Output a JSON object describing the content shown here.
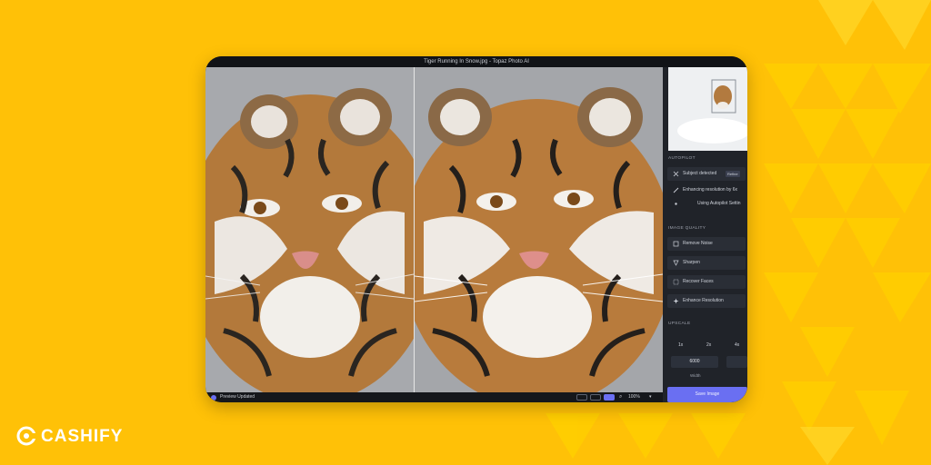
{
  "brand": {
    "name": "CASHIFY"
  },
  "window": {
    "title": "Tiger Running In Snow.jpg - Topaz Photo AI"
  },
  "status": {
    "text": "Preview Updated",
    "zoom": "100%"
  },
  "panel": {
    "autopilot_label": "AUTOPILOT",
    "autopilot_items": [
      {
        "label": "Subject detected",
        "badge": "Refine"
      },
      {
        "label": "Enhancing resolution by 6x"
      },
      {
        "label": "Using Autopilot Settin"
      }
    ],
    "quality_label": "IMAGE QUALITY",
    "quality_items": [
      {
        "label": "Remove Noise"
      },
      {
        "label": "Sharpen"
      },
      {
        "label": "Recover Faces"
      },
      {
        "label": "Enhance Resolution"
      }
    ],
    "upscale_label": "UPSCALE",
    "upscale_options": [
      "1x",
      "2x",
      "4x"
    ],
    "width_value": "6000",
    "width_label": "Width",
    "save_label": "Save Image"
  },
  "colors": {
    "background": "#ffc107",
    "accent": "#6a6ff2",
    "panel": "#202329"
  }
}
